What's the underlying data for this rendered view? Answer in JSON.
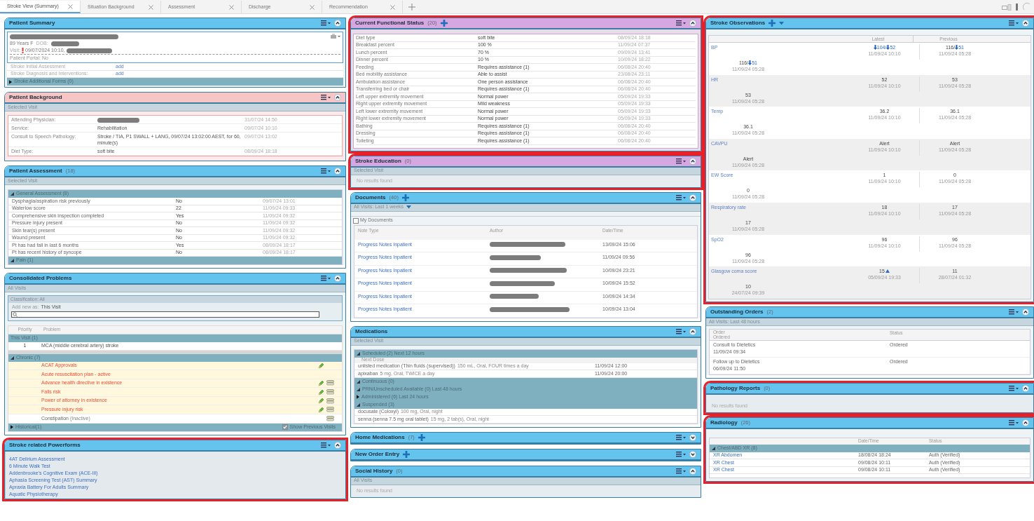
{
  "tabs": [
    {
      "label": "Stroke View (Summary)",
      "selected": true
    },
    {
      "label": "Situation Background",
      "selected": false
    },
    {
      "label": "Assessment",
      "selected": false
    },
    {
      "label": "Discharge",
      "selected": false
    },
    {
      "label": "Recommendation",
      "selected": false
    }
  ],
  "columns": [
    {
      "panels": [
        {
          "kind": "summary",
          "title": "Patient Summary",
          "color": "#64c4ed",
          "expanded": true,
          "highlighted": false,
          "name_redacted": true,
          "age_sex": "89 Years F",
          "dob_label": "DOB:",
          "visit_label": "Visit:",
          "visit": "09/07/2024 10:10,",
          "portal": "Patient Portal: No",
          "links": [
            {
              "label": "Stroke Initial Assessment",
              "action": "add"
            },
            {
              "label": "Stroke Diagnosis and Interventions:",
              "action": "add"
            }
          ],
          "group": {
            "label": "Stroke Additional Forms (0)",
            "expanded": false
          }
        },
        {
          "kind": "background",
          "title": "Patient Background",
          "color": "#f6c5c5",
          "expanded": true,
          "highlighted": false,
          "filter": "Selected Visit",
          "rows": [
            {
              "label": "Attending Physician:",
              "redacted": true,
              "date": "31/07/24 14:50"
            },
            {
              "label": "Service:",
              "value": "Rehabilitation",
              "date": "09/07/24 10:10",
              "redacted": false
            },
            {
              "label": "Consult to Speech Pathology:",
              "value": "Stroke / TIA, P1 SWALL + LANG, 09/07/24 13:02:00 AEST, for 60, minute(s)",
              "date": "09/07/24 13:02",
              "redacted": false
            },
            {
              "label": "Diet Type:",
              "value": "soft bite",
              "date": "08/09/24 18:18",
              "redacted": false
            }
          ]
        },
        {
          "kind": "assessment",
          "title": "Patient Assessment",
          "count": "(18)",
          "color": "#64c4ed",
          "expanded": true,
          "highlighted": false,
          "filter": "Selected Visit",
          "groups": [
            {
              "label": "General Assessment (8)",
              "expanded": true,
              "rows": [
                {
                  "label": "Dysphagia/aspiration risk previously",
                  "value": "No",
                  "date": "09/07/24 13:01"
                },
                {
                  "label": "Waterlow score",
                  "value": "22",
                  "date": "11/09/24 09:33"
                },
                {
                  "label": "Comprehensive skin inspection completed",
                  "value": "Yes",
                  "date": "11/09/24 09:32"
                },
                {
                  "label": "Pressure injury present",
                  "value": "No",
                  "date": "11/09/24 09:32"
                },
                {
                  "label": "Skin tear(s) present",
                  "value": "No",
                  "date": "11/09/24 09:32"
                },
                {
                  "label": "Wound present",
                  "value": "No",
                  "date": "11/09/24 09:32"
                },
                {
                  "label": "Pt has had fall in last 6 months",
                  "value": "Yes",
                  "date": "08/09/24 18:17"
                },
                {
                  "label": "Pt has recent history of syncope",
                  "value": "No",
                  "date": "08/09/24 18:17"
                }
              ]
            },
            {
              "label": "Pain (1)",
              "expanded": true
            }
          ]
        },
        {
          "kind": "problems",
          "title": "Consolidated Problems",
          "color": "#64c4ed",
          "expanded": true,
          "highlighted": false,
          "filter": "All Visits",
          "classification": "Classification: All",
          "add_label": "Add new as:",
          "add_value": "This Visit",
          "columns": [
            "Priority",
            "Problem"
          ],
          "current": {
            "label": "This Visit (1)",
            "rows": [
              {
                "priority": "1",
                "problem": "MCA (middle cerebral artery) stroke"
              }
            ]
          },
          "groups": [
            {
              "label": "Chronic (7)",
              "expanded": true,
              "rows": [
                {
                  "problem": "ACAT Approvals",
                  "active": true,
                  "editable": true,
                  "annotated": false
                },
                {
                  "problem": "Acute resuscitation plan - active",
                  "active": true,
                  "editable": false,
                  "annotated": false
                },
                {
                  "problem": "Advance health directive in existence",
                  "active": true,
                  "editable": true,
                  "annotated": true
                },
                {
                  "problem": "Falls risk",
                  "active": true,
                  "editable": true,
                  "annotated": true
                },
                {
                  "problem": "Power of attorney in existence",
                  "active": true,
                  "editable": true,
                  "annotated": true
                },
                {
                  "problem": "Pressure injury risk",
                  "active": true,
                  "editable": true,
                  "annotated": true
                },
                {
                  "problem": "Constipation",
                  "note": "(Inactive)",
                  "active": false,
                  "editable": false,
                  "annotated": true
                }
              ]
            },
            {
              "label": "Historical(1)",
              "expanded": false
            }
          ],
          "show_previous": {
            "label": "Show Previous Visits",
            "checked": true
          }
        },
        {
          "kind": "links",
          "title": "Stroke related Powerforms",
          "color": "#64c4ed",
          "expanded": true,
          "highlighted": true,
          "items": [
            "4AT Delirium Assessment",
            "6 Minute Walk Test",
            "Addenbrooke's Cognitive Exam (ACE-III)",
            "Aphasia Screening Test (AST) Summary",
            "Apraxia Battery For Adults Summary",
            "Aquatic Physiotherapy"
          ]
        }
      ]
    },
    {
      "panels": [
        {
          "kind": "status",
          "title": "Current Functional Status",
          "count": "(20)",
          "add": true,
          "color": "#d7a7e1",
          "expanded": true,
          "highlighted": true,
          "rows": [
            {
              "label": "Diet type",
              "value": "soft bite",
              "date": "08/09/24 18:18"
            },
            {
              "label": "Breakfast percent",
              "value": "100 %",
              "date": "11/09/24 07:37"
            },
            {
              "label": "Lunch percent",
              "value": "70 %",
              "date": "09/09/24 13:41"
            },
            {
              "label": "Dinner percent",
              "value": "10 %",
              "date": "10/09/24 18:22"
            },
            {
              "label": "Feeding",
              "value": "Requires assistance (1)",
              "date": "06/08/24 20:40"
            },
            {
              "label": "Bed mobility assistance",
              "value": "Able to assist",
              "date": "23/08/24 23:11"
            },
            {
              "label": "Ambulation assistance",
              "value": "One person assistance",
              "date": "06/08/24 20:40"
            },
            {
              "label": "Transferring bed or chair",
              "value": "Requires assistance (1)",
              "date": "06/08/24 20:40"
            },
            {
              "label": "Left upper extremity movement",
              "value": "Normal power",
              "date": "05/09/24 19:33"
            },
            {
              "label": "Right upper extremity movement",
              "value": "Mild weakness",
              "date": "05/09/24 19:33"
            },
            {
              "label": "Left lower extremity movement",
              "value": "Normal power",
              "date": "05/09/24 19:33"
            },
            {
              "label": "Right lower extremity movement",
              "value": "Normal power",
              "date": "05/09/24 19:33"
            },
            {
              "label": "Bathing",
              "value": "Requires assistance (1)",
              "date": "06/08/24 20:40"
            },
            {
              "label": "Dressing",
              "value": "Requires assistance (1)",
              "date": "06/08/24 20:40"
            },
            {
              "label": "Toileting",
              "value": "Requires assistance (1)",
              "date": "06/08/24 20:40"
            }
          ]
        },
        {
          "kind": "empty",
          "title": "Stroke Education",
          "count": "(0)",
          "color": "#d7a7e1",
          "expanded": true,
          "highlighted": true,
          "filter": "Selected Visit",
          "empty": "No results found"
        },
        {
          "kind": "documents",
          "title": "Documents",
          "count": "(40)",
          "add": true,
          "color": "#64c4ed",
          "expanded": true,
          "highlighted": false,
          "filter": "All Visits: Last 1 weeks",
          "filter_dropdown": true,
          "checkbox": {
            "label": "My Documents",
            "checked": false
          },
          "columns": [
            "Note Type",
            "Author",
            "Date/Time"
          ],
          "rows": [
            {
              "type": "Progress Notes Inpatient",
              "redacted": true,
              "date": "13/09/24 15:06"
            },
            {
              "type": "Progress Notes Inpatient",
              "redacted": true,
              "date": "11/09/24 09:56"
            },
            {
              "type": "Progress Notes Inpatient",
              "redacted": true,
              "date": "10/09/24 23:21"
            },
            {
              "type": "Progress Notes Inpatient",
              "redacted": true,
              "date": "10/09/24 15:52"
            },
            {
              "type": "Progress Notes Inpatient",
              "redacted": true,
              "date": "10/09/24 14:34"
            },
            {
              "type": "Progress Notes Inpatient",
              "redacted": true,
              "date": "10/09/24 13:04"
            }
          ]
        },
        {
          "kind": "medications",
          "title": "Medications",
          "color": "#64c4ed",
          "expanded": true,
          "highlighted": false,
          "filter": "Selected Visit",
          "groups": [
            {
              "label": "Scheduled (2) Next 12 hours",
              "expanded": true,
              "subheader": "Next Dose",
              "rows": [
                {
                  "name": "unlisted medication (Thin fluids (supervised))",
                  "detail": "150 mL, Oral, FOUR times a day",
                  "date": "11/09/24 12:00"
                },
                {
                  "name": "apixaban",
                  "detail": "5 mg, Oral, TWICE a day",
                  "date": "11/09/24 20:00"
                }
              ]
            },
            {
              "label": "Continuous (0)",
              "expanded": true
            },
            {
              "label": "PRN/Unscheduled Available (0) Last 48 hours",
              "expanded": true
            },
            {
              "label": "Administered (6) Last 24 hours",
              "expanded": false
            },
            {
              "label": "Suspended (3)",
              "expanded": true,
              "rows": [
                {
                  "name": "docusate (Coloxyl)",
                  "detail": "100 mg, Oral, night"
                },
                {
                  "name": "senna (senna 7.5 mg oral tablet)",
                  "detail": "15 mg, 2 tab(s), Oral, night"
                }
              ]
            }
          ]
        },
        {
          "kind": "collapsed",
          "title": "Home Medications",
          "count": "(7)",
          "add": true,
          "color": "#64c4ed",
          "expanded": false,
          "highlighted": false
        },
        {
          "kind": "collapsed",
          "title": "New Order Entry",
          "add": true,
          "color": "#64c4ed",
          "expanded": false,
          "highlighted": false
        },
        {
          "kind": "empty",
          "title": "Social History",
          "count": "(0)",
          "color": "#64c4ed",
          "expanded": true,
          "highlighted": false,
          "filter": "All Visits",
          "empty": "No results found"
        }
      ]
    },
    {
      "panels": [
        {
          "kind": "observations",
          "title": "Stroke Observations",
          "add": true,
          "dropdown": true,
          "color": "#64c4ed",
          "expanded": true,
          "highlighted": true,
          "columns": [
            "Latest",
            "Previous"
          ],
          "rows": [
            {
              "label": "BP",
              "latest": {
                "parts": [
                  {
                    "text": "104/",
                    "low": true,
                    "high": false
                  },
                  {
                    "text": "52",
                    "low": true,
                    "high": false
                  }
                ],
                "date": "11/09/24 10:10"
              },
              "previous": {
                "parts": [
                  {
                    "text": "116/",
                    "low": false,
                    "high": false
                  },
                  {
                    "text": "51",
                    "low": true,
                    "high": false
                  }
                ],
                "date": "11/09/24 05:28"
              },
              "extra": {
                "parts": [
                  {
                    "text": "116/",
                    "low": false,
                    "high": false
                  },
                  {
                    "text": "51",
                    "low": true,
                    "high": false
                  }
                ],
                "date": "11/09/24 05:28"
              }
            },
            {
              "label": "HR",
              "latest": {
                "parts": [
                  {
                    "text": "52",
                    "low": false,
                    "high": false
                  }
                ],
                "date": "11/09/24 10:10"
              },
              "previous": {
                "parts": [
                  {
                    "text": "53",
                    "low": false,
                    "high": false
                  }
                ],
                "date": "11/09/24 05:28"
              },
              "extra": {
                "parts": [
                  {
                    "text": "53",
                    "low": false,
                    "high": false
                  }
                ],
                "date": "11/09/24 05:28"
              }
            },
            {
              "label": "Temp",
              "latest": {
                "parts": [
                  {
                    "text": "36.2",
                    "low": false,
                    "high": false
                  }
                ],
                "date": "11/09/24 10:10"
              },
              "previous": {
                "parts": [
                  {
                    "text": "36.1",
                    "low": false,
                    "high": false
                  }
                ],
                "date": "11/09/24 05:28"
              },
              "extra": {
                "parts": [
                  {
                    "text": "36.1",
                    "low": false,
                    "high": false
                  }
                ],
                "date": "11/09/24 05:28"
              }
            },
            {
              "label": "CAVPU",
              "latest": {
                "parts": [
                  {
                    "text": "Alert",
                    "low": false,
                    "high": false
                  }
                ],
                "date": "11/09/24 10:10"
              },
              "previous": {
                "parts": [
                  {
                    "text": "Alert",
                    "low": false,
                    "high": false
                  }
                ],
                "date": "11/09/24 05:28"
              },
              "extra": {
                "parts": [
                  {
                    "text": "Alert",
                    "low": false,
                    "high": false
                  }
                ],
                "date": "11/09/24 05:28"
              }
            },
            {
              "label": "EW Score",
              "latest": {
                "parts": [
                  {
                    "text": "1",
                    "low": false,
                    "high": false
                  }
                ],
                "date": "11/09/24 10:10"
              },
              "previous": {
                "parts": [
                  {
                    "text": "0",
                    "low": false,
                    "high": false
                  }
                ],
                "date": "11/09/24 05:28"
              },
              "extra": {
                "parts": [
                  {
                    "text": "0",
                    "low": false,
                    "high": false
                  }
                ],
                "date": "11/09/24 05:28"
              }
            },
            {
              "label": "Respiratory rate",
              "latest": {
                "parts": [
                  {
                    "text": "18",
                    "low": false,
                    "high": false
                  }
                ],
                "date": "11/09/24 10:10"
              },
              "previous": {
                "parts": [
                  {
                    "text": "17",
                    "low": false,
                    "high": false
                  }
                ],
                "date": "11/09/24 05:28"
              },
              "extra": {
                "parts": [
                  {
                    "text": "17",
                    "low": false,
                    "high": false
                  }
                ],
                "date": "11/09/24 05:28"
              }
            },
            {
              "label": "SpO2",
              "latest": {
                "parts": [
                  {
                    "text": "96",
                    "low": false,
                    "high": false
                  }
                ],
                "date": "11/09/24 10:10"
              },
              "previous": {
                "parts": [
                  {
                    "text": "96",
                    "low": false,
                    "high": false
                  }
                ],
                "date": "11/09/24 05:28"
              },
              "extra": {
                "parts": [
                  {
                    "text": "96",
                    "low": false,
                    "high": false
                  }
                ],
                "date": "11/09/24 05:28"
              }
            },
            {
              "label": "Glasgow coma score",
              "latest": {
                "parts": [
                  {
                    "text": "15",
                    "low": false,
                    "high": true
                  }
                ],
                "date": "05/09/24 19:33"
              },
              "previous": {
                "parts": [
                  {
                    "text": "11",
                    "low": false,
                    "high": false
                  }
                ],
                "date": "28/07/24 01:32"
              },
              "extra": {
                "parts": [
                  {
                    "text": "10",
                    "low": false,
                    "high": false
                  }
                ],
                "date": "24/07/24 09:39"
              }
            }
          ]
        },
        {
          "kind": "orders",
          "title": "Outstanding Orders",
          "count": "(2)",
          "color": "#64c4ed",
          "expanded": true,
          "highlighted": false,
          "filter": "All Visits: Last 48 hours",
          "columns": [
            "Order",
            "Ordered",
            "Status"
          ],
          "rows": [
            {
              "order": "Consult to Dietetics",
              "date": "11/09/24 09:34",
              "status": "Ordered"
            },
            {
              "order": "Follow up to Dietetics",
              "date": "06/09/24 11:50",
              "status": "Ordered"
            }
          ]
        },
        {
          "kind": "empty",
          "title": "Pathology Reports",
          "count": "(0)",
          "color": "#64c4ed",
          "expanded": true,
          "highlighted": true,
          "empty": "No results found"
        },
        {
          "kind": "radiology",
          "title": "Radiology",
          "count": "(26)",
          "color": "#64c4ed",
          "expanded": true,
          "highlighted": true,
          "columns": [
            "Date/Time",
            "Status"
          ],
          "group": {
            "label": "Chest/ABD XR (8)",
            "expanded": true,
            "rows": [
              {
                "name": "XR Abdomen",
                "date": "18/08/24 18:24",
                "status": "Auth (Verified)"
              },
              {
                "name": "XR Chest",
                "date": "09/08/24 10:11",
                "status": "Auth (Verified)"
              },
              {
                "name": "XR Chest",
                "date": "09/08/24 10:11",
                "status": "Auth (Verified)"
              }
            ]
          }
        }
      ]
    }
  ]
}
